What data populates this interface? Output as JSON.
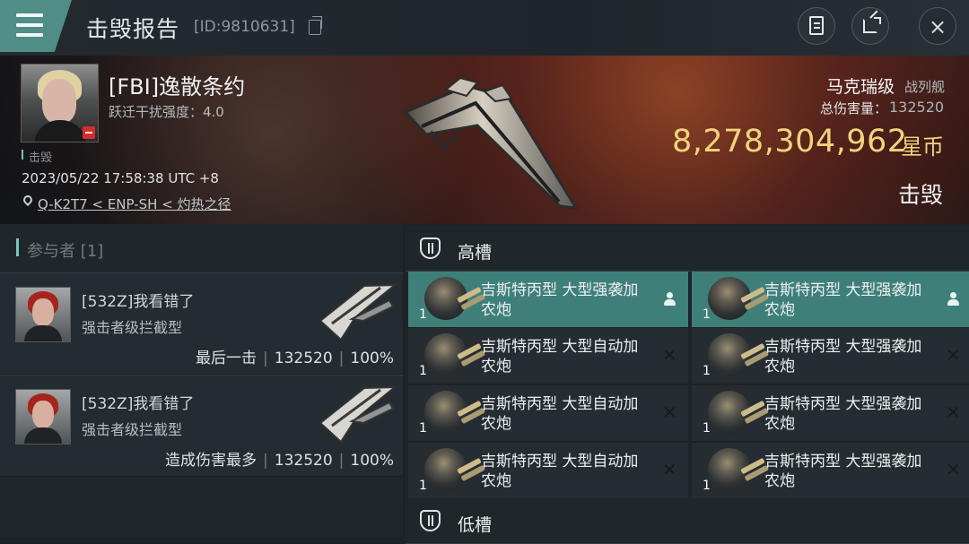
{
  "header": {
    "title": "击毁报告",
    "report_id": "[ID:9810631]",
    "icons": {
      "menu": "menu-icon",
      "copy": "copy-icon",
      "clipboard": "clipboard-icon",
      "share": "share-icon",
      "close": "close-icon"
    },
    "close_text": "×"
  },
  "victim": {
    "name": "[FBI]逸散条约",
    "warp_text": "跃迁干扰强度：4.0",
    "status_label": "击毁",
    "datetime": "2023/05/22 17:58:38 UTC +8",
    "location": "Q-K2T7 < ENP-SH < 灼热之径"
  },
  "ship": {
    "name": "马克瑞级",
    "class": "战列舰",
    "total_damage_label": "总伤害量：",
    "total_damage_value": "132520",
    "isk_value": "8,278,304,962",
    "isk_unit": "星币",
    "result": "击毁"
  },
  "participants": {
    "title": "参与者 [1]",
    "items": [
      {
        "name": "[532Z]我看错了",
        "ship": "强击者级拦截型",
        "label": "最后一击",
        "damage": "132520",
        "percent": "100%"
      },
      {
        "name": "[532Z]我看错了",
        "ship": "强击者级拦截型",
        "label": "造成伤害最多",
        "damage": "132520",
        "percent": "100%"
      }
    ]
  },
  "slots": {
    "high_title": "高槽",
    "low_title": "低槽",
    "modules": [
      {
        "name": "吉斯特丙型 大型强袭加农炮",
        "qty": "1",
        "status": "user-icon",
        "active": true
      },
      {
        "name": "吉斯特丙型 大型强袭加农炮",
        "qty": "1",
        "status": "user-icon",
        "active": true
      },
      {
        "name": "吉斯特丙型 大型自动加农炮",
        "qty": "1",
        "status": "close-icon",
        "active": false
      },
      {
        "name": "吉斯特丙型 大型强袭加农炮",
        "qty": "1",
        "status": "close-icon",
        "active": false
      },
      {
        "name": "吉斯特丙型 大型自动加农炮",
        "qty": "1",
        "status": "close-icon",
        "active": false
      },
      {
        "name": "吉斯特丙型 大型强袭加农炮",
        "qty": "1",
        "status": "close-icon",
        "active": false
      },
      {
        "name": "吉斯特丙型 大型自动加农炮",
        "qty": "1",
        "status": "close-icon",
        "active": false
      },
      {
        "name": "吉斯特丙型 大型强袭加农炮",
        "qty": "1",
        "status": "close-icon",
        "active": false
      }
    ]
  },
  "colors": {
    "accent": "#4f8d86",
    "isk": "#f2d37c",
    "killed": "#d72c2c"
  }
}
